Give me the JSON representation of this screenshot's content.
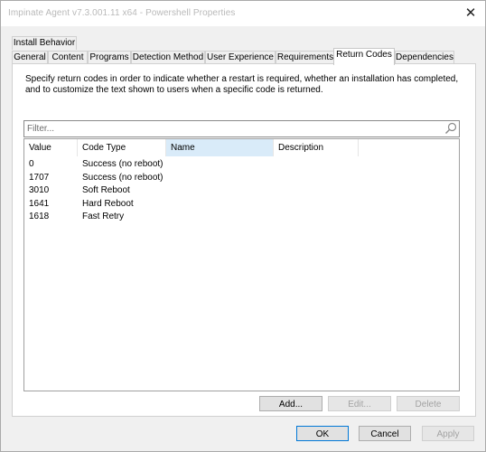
{
  "window": {
    "title": "Impinate Agent v7.3.001.11 x64 - Powershell Properties",
    "close_glyph": "✕"
  },
  "tabs_row1": [
    {
      "label": "Install Behavior"
    }
  ],
  "tabs_row2": [
    {
      "label": "General"
    },
    {
      "label": "Content"
    },
    {
      "label": "Programs"
    },
    {
      "label": "Detection Method"
    },
    {
      "label": "User Experience"
    },
    {
      "label": "Requirements"
    },
    {
      "label": "Return Codes",
      "active": true
    },
    {
      "label": "Dependencies"
    }
  ],
  "description": "Specify return codes in order to indicate whether a restart is required, whether an installation has completed, and to customize the text shown to users when a specific code is returned.",
  "filter": {
    "placeholder": "Filter..."
  },
  "table": {
    "columns": [
      "Value",
      "Code Type",
      "Name",
      "Description"
    ],
    "selected_column": "Name",
    "rows": [
      {
        "value": "0",
        "code_type": "Success (no reboot)",
        "name": "",
        "description": ""
      },
      {
        "value": "1707",
        "code_type": "Success (no reboot)",
        "name": "",
        "description": ""
      },
      {
        "value": "3010",
        "code_type": "Soft Reboot",
        "name": "",
        "description": ""
      },
      {
        "value": "1641",
        "code_type": "Hard Reboot",
        "name": "",
        "description": ""
      },
      {
        "value": "1618",
        "code_type": "Fast Retry",
        "name": "",
        "description": ""
      }
    ]
  },
  "list_buttons": {
    "add": "Add...",
    "edit": "Edit...",
    "delete": "Delete"
  },
  "dialog_buttons": {
    "ok": "OK",
    "cancel": "Cancel",
    "apply": "Apply"
  },
  "colors": {
    "accent": "#0078d7",
    "selected_header": "#d9ebf9",
    "window_bg": "#f0f0f0"
  }
}
